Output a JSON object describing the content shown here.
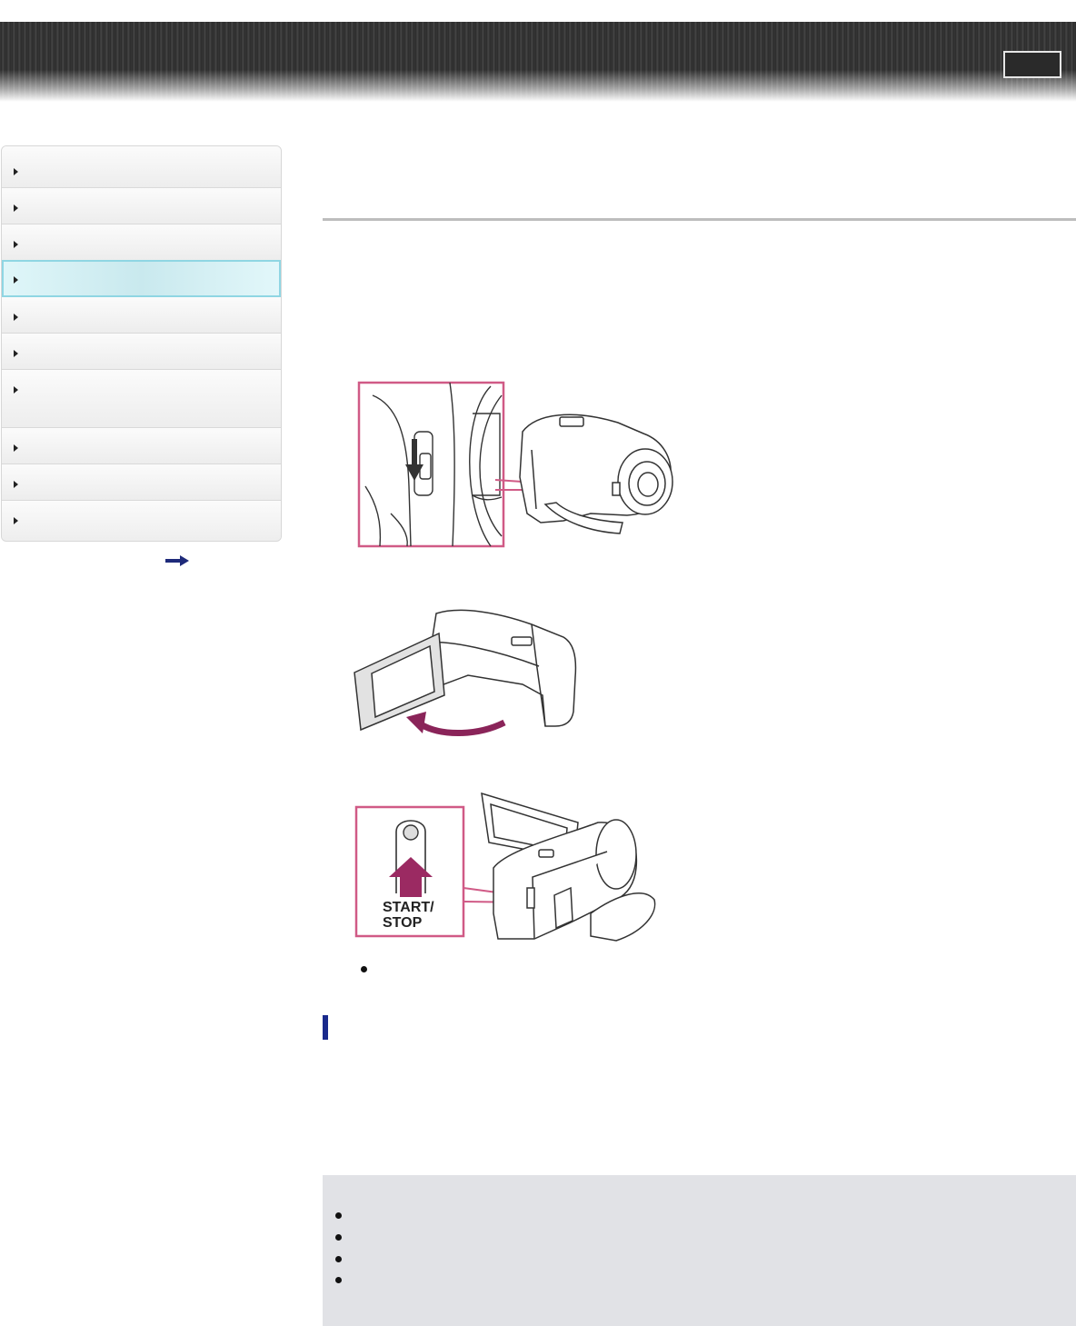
{
  "header": {
    "title": "",
    "button_label": ""
  },
  "sidebar": {
    "items": [
      {
        "label": ""
      },
      {
        "label": ""
      },
      {
        "label": ""
      },
      {
        "label": "",
        "active": true
      },
      {
        "label": ""
      },
      {
        "label": ""
      },
      {
        "label": ""
      },
      {
        "label": ""
      },
      {
        "label": ""
      },
      {
        "label": ""
      }
    ],
    "more_icon": "right-arrow-icon"
  },
  "main": {
    "figures": [
      {
        "name": "power-switch-figure",
        "icon": "camcorder-lens-cover-switch"
      },
      {
        "name": "open-lcd-figure",
        "icon": "camcorder-open-lcd"
      },
      {
        "name": "start-stop-figure",
        "icon": "camcorder-start-stop-button"
      }
    ],
    "figure_labels": {
      "start_stop_line1": "START/",
      "start_stop_line2": "STOP"
    }
  },
  "colors": {
    "accent_bar": "#1a2a8c",
    "callout_pink": "#c9507a",
    "arrow_purple": "#9b2a62",
    "active_nav": "#8fd6e3",
    "note_bg": "#e1e2e6"
  }
}
